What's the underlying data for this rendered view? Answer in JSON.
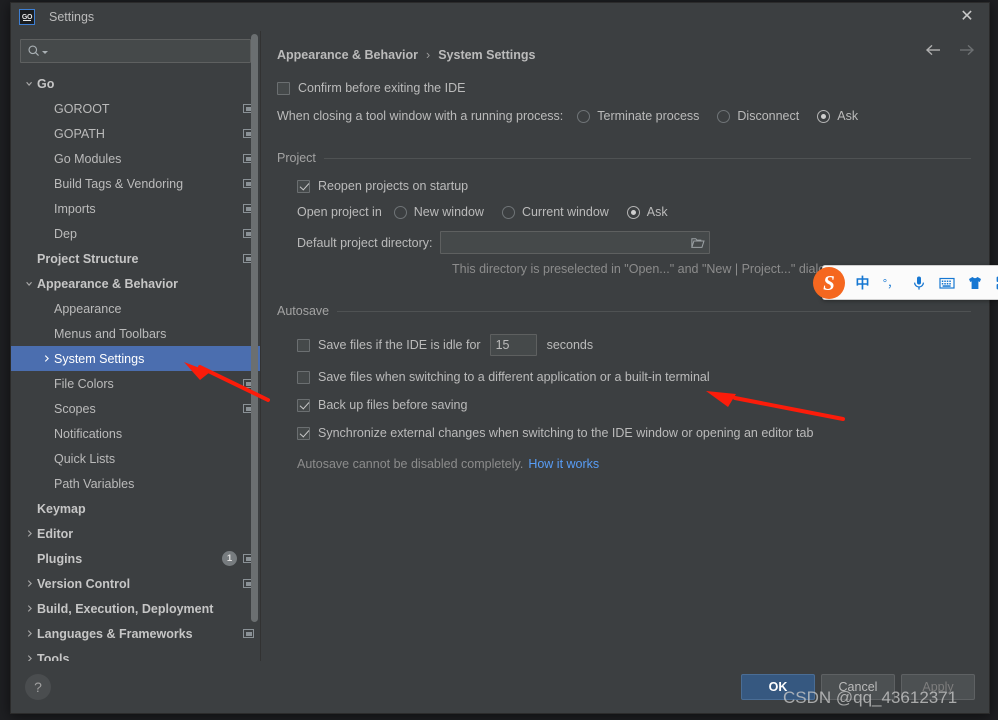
{
  "window": {
    "title": "Settings",
    "app_icon": "goland-go-icon",
    "close_label": "✕"
  },
  "search": {
    "value": "",
    "placeholder": ""
  },
  "sidebar": {
    "items": [
      {
        "label": "Go",
        "depth": 0,
        "bold": true,
        "twisty": "down",
        "mini": false
      },
      {
        "label": "GOROOT",
        "depth": 1,
        "bold": false,
        "twisty": "none",
        "mini": true
      },
      {
        "label": "GOPATH",
        "depth": 1,
        "bold": false,
        "twisty": "none",
        "mini": true
      },
      {
        "label": "Go Modules",
        "depth": 1,
        "bold": false,
        "twisty": "none",
        "mini": true
      },
      {
        "label": "Build Tags & Vendoring",
        "depth": 1,
        "bold": false,
        "twisty": "none",
        "mini": true
      },
      {
        "label": "Imports",
        "depth": 1,
        "bold": false,
        "twisty": "none",
        "mini": true
      },
      {
        "label": "Dep",
        "depth": 1,
        "bold": false,
        "twisty": "none",
        "mini": true
      },
      {
        "label": "Project Structure",
        "depth": 0,
        "bold": true,
        "twisty": "none",
        "mini": true
      },
      {
        "label": "Appearance & Behavior",
        "depth": 0,
        "bold": true,
        "twisty": "down",
        "mini": false
      },
      {
        "label": "Appearance",
        "depth": 1,
        "bold": false,
        "twisty": "none",
        "mini": false
      },
      {
        "label": "Menus and Toolbars",
        "depth": 1,
        "bold": false,
        "twisty": "none",
        "mini": false
      },
      {
        "label": "System Settings",
        "depth": 1,
        "bold": false,
        "twisty": "right",
        "mini": false,
        "selected": true
      },
      {
        "label": "File Colors",
        "depth": 1,
        "bold": false,
        "twisty": "none",
        "mini": true
      },
      {
        "label": "Scopes",
        "depth": 1,
        "bold": false,
        "twisty": "none",
        "mini": true
      },
      {
        "label": "Notifications",
        "depth": 1,
        "bold": false,
        "twisty": "none",
        "mini": false
      },
      {
        "label": "Quick Lists",
        "depth": 1,
        "bold": false,
        "twisty": "none",
        "mini": false
      },
      {
        "label": "Path Variables",
        "depth": 1,
        "bold": false,
        "twisty": "none",
        "mini": false
      },
      {
        "label": "Keymap",
        "depth": 0,
        "bold": true,
        "twisty": "none",
        "mini": false
      },
      {
        "label": "Editor",
        "depth": 0,
        "bold": true,
        "twisty": "right",
        "mini": false
      },
      {
        "label": "Plugins",
        "depth": 0,
        "bold": true,
        "twisty": "none",
        "mini": true,
        "badge": "1"
      },
      {
        "label": "Version Control",
        "depth": 0,
        "bold": true,
        "twisty": "right",
        "mini": true
      },
      {
        "label": "Build, Execution, Deployment",
        "depth": 0,
        "bold": true,
        "twisty": "right",
        "mini": false
      },
      {
        "label": "Languages & Frameworks",
        "depth": 0,
        "bold": true,
        "twisty": "right",
        "mini": true
      },
      {
        "label": "Tools",
        "depth": 0,
        "bold": true,
        "twisty": "right",
        "mini": false
      }
    ]
  },
  "main": {
    "breadcrumb": {
      "parent": "Appearance & Behavior",
      "separator": "›",
      "current": "System Settings"
    },
    "nav": {
      "back": "back-arrow",
      "forward": "forward-arrow"
    },
    "confirm_exit": {
      "label": "Confirm before exiting the IDE",
      "checked": false
    },
    "tool_window": {
      "label": "When closing a tool window with a running process:",
      "options": [
        {
          "label": "Terminate process",
          "selected": false
        },
        {
          "label": "Disconnect",
          "selected": false
        },
        {
          "label": "Ask",
          "selected": true
        }
      ]
    },
    "project": {
      "group_title": "Project",
      "reopen": {
        "label": "Reopen projects on startup",
        "checked": true
      },
      "open_in_label": "Open project in",
      "open_in_options": [
        {
          "label": "New window",
          "selected": false
        },
        {
          "label": "Current window",
          "selected": false
        },
        {
          "label": "Ask",
          "selected": true
        }
      ],
      "default_dir_label": "Default project directory:",
      "default_dir_value": "",
      "hint": "This directory is preselected in \"Open...\" and \"New | Project...\" dialogs"
    },
    "autosave": {
      "group_title": "Autosave",
      "idle": {
        "label_before": "Save files if the IDE is idle for",
        "value": "15",
        "label_after": "seconds",
        "checked": false
      },
      "checkboxes": [
        {
          "label": "Save files when switching to a different application or a built-in terminal",
          "checked": false
        },
        {
          "label": "Back up files before saving",
          "checked": true
        },
        {
          "label": "Synchronize external changes when switching to the IDE window or opening an editor tab",
          "checked": true
        }
      ],
      "note": "Autosave cannot be disabled completely.",
      "note_link": "How it works"
    }
  },
  "footer": {
    "help": "?",
    "ok": "OK",
    "cancel": "Cancel",
    "apply": "Apply"
  },
  "ime_toolbar": {
    "logo": "S",
    "items": [
      {
        "name": "chinese-mode-icon",
        "glyph": "中"
      },
      {
        "name": "punctuation-mode-icon",
        "glyph": "°，"
      },
      {
        "name": "microphone-icon",
        "glyph": "mic"
      },
      {
        "name": "keyboard-icon",
        "glyph": "keyboard"
      },
      {
        "name": "skin-icon",
        "glyph": "shirt"
      },
      {
        "name": "toolbox-icon",
        "glyph": "grid"
      }
    ]
  },
  "watermark": {
    "text": "CSDN @qq_43612371"
  },
  "colors": {
    "selection": "#4b6eaf",
    "panel": "#3c3f41",
    "primary_button": "#365880",
    "link": "#589df6",
    "annotation": "#fb1c0a",
    "ime_accent": "#1677d2",
    "ime_logo": "#f5671f"
  }
}
